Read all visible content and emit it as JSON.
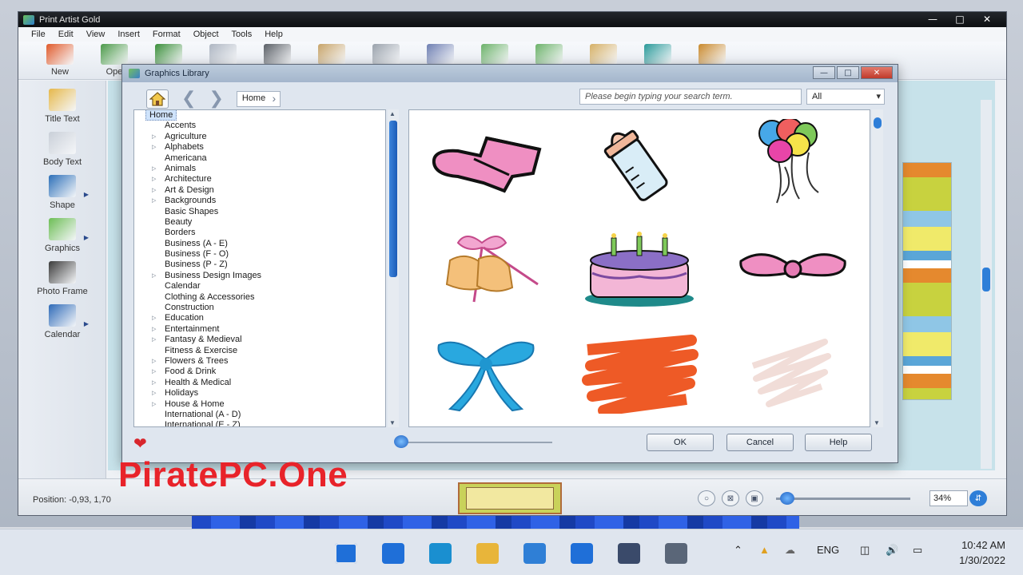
{
  "app": {
    "title": "Print Artist Gold",
    "window_controls": [
      "—",
      "□",
      "✕"
    ],
    "menu": [
      "File",
      "Edit",
      "View",
      "Insert",
      "Format",
      "Object",
      "Tools",
      "Help"
    ],
    "toolbar": [
      {
        "label": "New",
        "icon": "new-project-icon",
        "color": "#e05a2b"
      },
      {
        "label": "Ope",
        "icon": "open-icon",
        "color": "#4c9a4a"
      },
      {
        "label": "",
        "icon": "download-icon",
        "color": "#3b8f3b"
      },
      {
        "label": "",
        "icon": "page-icon",
        "color": "#aeb6c2"
      },
      {
        "label": "",
        "icon": "print-icon",
        "color": "#5a5f66"
      },
      {
        "label": "",
        "icon": "pencil-icon",
        "color": "#c7a46a"
      },
      {
        "label": "",
        "icon": "scanner-icon",
        "color": "#9aa2ac"
      },
      {
        "label": "",
        "icon": "bottle-icon",
        "color": "#6e7fb2"
      },
      {
        "label": "",
        "icon": "undo-icon",
        "color": "#6cb26a"
      },
      {
        "label": "",
        "icon": "redo-icon",
        "color": "#6cb26a"
      },
      {
        "label": "",
        "icon": "palette-icon",
        "color": "#d5b067"
      },
      {
        "label": "",
        "icon": "teal-box-icon",
        "color": "#2a9a9a"
      },
      {
        "label": "",
        "icon": "figure-icon",
        "color": "#c98a2e"
      }
    ],
    "left_panel": [
      {
        "label": "Title Text",
        "icon": "title-text-icon",
        "color": "#e6b84a",
        "submenu": false
      },
      {
        "label": "Body Text",
        "icon": "body-text-icon",
        "color": "#c9cfd8",
        "submenu": false
      },
      {
        "label": "Shape",
        "icon": "shape-icon",
        "color": "#2c6fb8",
        "submenu": true
      },
      {
        "label": "Graphics",
        "icon": "graphics-icon",
        "color": "#6cbd54",
        "submenu": true
      },
      {
        "label": "Photo Frame",
        "icon": "photo-frame-icon",
        "color": "#3a3a3a",
        "submenu": false
      },
      {
        "label": "Calendar",
        "icon": "calendar-icon",
        "color": "#2e6ab8",
        "submenu": true
      }
    ],
    "status": {
      "position": "Position: -0,93, 1,70",
      "zoom": "34%",
      "zoom_level": 0.02
    }
  },
  "dialog": {
    "title": "Graphics Library",
    "breadcrumb": "Home",
    "search_placeholder": "Please begin typing your search term.",
    "filter": "All",
    "categories": [
      {
        "label": "Home",
        "root": true,
        "expandable": false
      },
      {
        "label": "Accents",
        "expandable": false
      },
      {
        "label": "Agriculture",
        "expandable": true
      },
      {
        "label": "Alphabets",
        "expandable": true
      },
      {
        "label": "Americana",
        "expandable": false
      },
      {
        "label": "Animals",
        "expandable": true
      },
      {
        "label": "Architecture",
        "expandable": true
      },
      {
        "label": "Art & Design",
        "expandable": true
      },
      {
        "label": "Backgrounds",
        "expandable": true
      },
      {
        "label": "Basic Shapes",
        "expandable": false
      },
      {
        "label": "Beauty",
        "expandable": false
      },
      {
        "label": "Borders",
        "expandable": false
      },
      {
        "label": "Business (A - E)",
        "expandable": false
      },
      {
        "label": "Business (F - O)",
        "expandable": false
      },
      {
        "label": "Business (P - Z)",
        "expandable": false
      },
      {
        "label": "Business Design Images",
        "expandable": true
      },
      {
        "label": "Calendar",
        "expandable": false
      },
      {
        "label": "Clothing & Accessories",
        "expandable": false
      },
      {
        "label": "Construction",
        "expandable": false
      },
      {
        "label": "Education",
        "expandable": true
      },
      {
        "label": "Entertainment",
        "expandable": true
      },
      {
        "label": "Fantasy & Medieval",
        "expandable": true
      },
      {
        "label": "Fitness & Exercise",
        "expandable": false
      },
      {
        "label": "Flowers & Trees",
        "expandable": true
      },
      {
        "label": "Food & Drink",
        "expandable": true
      },
      {
        "label": "Health & Medical",
        "expandable": true
      },
      {
        "label": "Holidays",
        "expandable": true
      },
      {
        "label": "House & Home",
        "expandable": true
      },
      {
        "label": "International (A - D)",
        "expandable": false
      },
      {
        "label": "International (E - Z)",
        "expandable": false
      }
    ],
    "graphics": [
      {
        "name": "pink-booties"
      },
      {
        "name": "baby-bottle"
      },
      {
        "name": "balloons"
      },
      {
        "name": "wedding-bells"
      },
      {
        "name": "birthday-cake"
      },
      {
        "name": "pink-bow"
      },
      {
        "name": "blue-bow"
      },
      {
        "name": "orange-scribble"
      },
      {
        "name": "faint-scribble"
      }
    ],
    "buttons": {
      "ok": "OK",
      "cancel": "Cancel",
      "help": "Help"
    }
  },
  "watermark": "PiratePC.One",
  "taskbar": {
    "apps": [
      {
        "icon": "windows-start-icon",
        "color": "#1f6fd8"
      },
      {
        "icon": "task-view-icon",
        "color": "#1f6fd8"
      },
      {
        "icon": "edge-icon",
        "color": "#1a8fd0"
      },
      {
        "icon": "file-explorer-icon",
        "color": "#e8b53a"
      },
      {
        "icon": "store-icon",
        "color": "#2f7fd6"
      },
      {
        "icon": "mail-icon",
        "color": "#1f6fd8"
      },
      {
        "icon": "app-icon",
        "color": "#3a4a6a"
      },
      {
        "icon": "settings-icon",
        "color": "#5a6678"
      }
    ],
    "language": "ENG",
    "time": "10:42 AM",
    "date": "1/30/2022"
  }
}
